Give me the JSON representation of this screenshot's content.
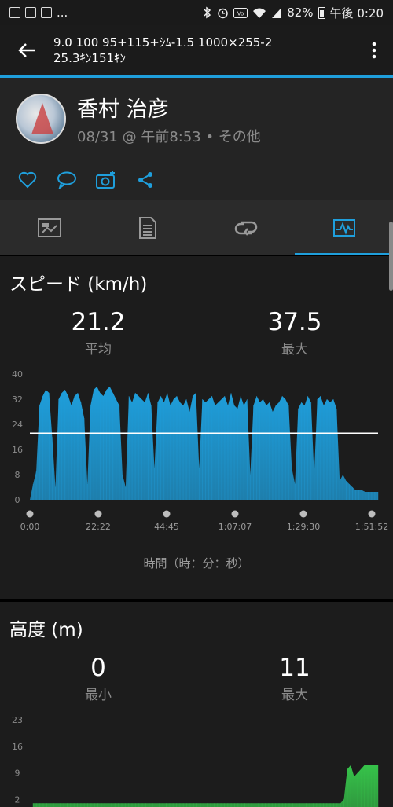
{
  "status_bar": {
    "left_extra": "...",
    "battery": "82%",
    "time": "午後 0:20"
  },
  "header": {
    "title_line1": "9.0 100 95+115+ｼﾑ-1.5 1000×255-2",
    "title_line2": "25.3ｷﾝ151ｷﾝ"
  },
  "profile": {
    "name": "香村 治彦",
    "meta": "08/31 @ 午前8:53 • その他"
  },
  "tabs": [
    {
      "icon": "summary-icon"
    },
    {
      "icon": "details-list-icon"
    },
    {
      "icon": "laps-icon"
    },
    {
      "icon": "chart-icon",
      "active": true
    }
  ],
  "speed": {
    "title": "スピード (km/h)",
    "avg_value": "21.2",
    "avg_label": "平均",
    "max_value": "37.5",
    "max_label": "最大",
    "axis_caption": "時間（時：分：秒）",
    "color": "#1f9fdc"
  },
  "elevation": {
    "title": "高度 (m)",
    "min_value": "0",
    "min_label": "最小",
    "max_value": "11",
    "max_label": "最大",
    "color": "#36c24a"
  },
  "chart_data": [
    {
      "type": "area",
      "title": "スピード (km/h)",
      "xlabel": "時間（時：分：秒）",
      "ylabel": "",
      "ylim": [
        0,
        40
      ],
      "yticks": [
        "0",
        "8",
        "16",
        "24",
        "32",
        "40"
      ],
      "xticks": [
        "0:00",
        "22:22",
        "44:45",
        "1:07:07",
        "1:29:30",
        "1:51:52"
      ],
      "average_line": 21.2,
      "series": [
        {
          "values": [
            0,
            5,
            9,
            30,
            33,
            35,
            34,
            20,
            4,
            32,
            34,
            35,
            33,
            30,
            33,
            34,
            31,
            26,
            5,
            30,
            35,
            36,
            34,
            33,
            35,
            36,
            34,
            32,
            30,
            8,
            4,
            33,
            31,
            34,
            33,
            32,
            31,
            34,
            30,
            10,
            31,
            33,
            31,
            34,
            30,
            32,
            33,
            31,
            30,
            32,
            28,
            33,
            34,
            10,
            32,
            31,
            32,
            33,
            30,
            31,
            32,
            33,
            30,
            34,
            30,
            29,
            33,
            30,
            32,
            8,
            30,
            33,
            31,
            32,
            30,
            31,
            28,
            30,
            31,
            33,
            32,
            30,
            10,
            5,
            29,
            31,
            30,
            33,
            31,
            8,
            32,
            33,
            30,
            32,
            31,
            32,
            29,
            6,
            8,
            6,
            5,
            4,
            3,
            3,
            3,
            2.5,
            2.5,
            2.5,
            2.5,
            2.5
          ]
        }
      ]
    },
    {
      "type": "area",
      "title": "高度 (m)",
      "xlabel": "",
      "ylabel": "",
      "ylim": [
        0,
        23
      ],
      "yticks": [
        "2",
        "9",
        "16",
        "23"
      ],
      "series": [
        {
          "values": [
            1,
            1,
            1,
            1,
            1,
            1,
            1,
            1,
            1,
            1,
            1,
            1,
            1,
            1,
            1,
            1,
            1,
            1,
            1,
            1,
            1,
            1,
            1,
            1,
            1,
            1,
            1,
            1,
            1,
            1,
            1,
            1,
            1,
            1,
            1,
            1,
            1,
            1,
            1,
            1,
            1,
            1,
            1,
            1,
            1,
            1,
            1,
            1,
            1,
            1,
            1,
            1,
            1,
            1,
            1,
            1,
            1,
            1,
            1,
            1,
            1,
            1,
            1,
            1,
            1,
            1,
            1,
            1,
            1,
            1,
            1,
            1,
            1,
            1,
            1,
            1,
            1,
            1,
            1,
            1,
            1,
            1,
            1,
            1,
            1,
            1,
            1,
            1,
            1,
            1,
            1,
            2,
            10,
            11,
            8,
            9,
            10,
            11,
            11,
            11,
            11,
            11
          ]
        }
      ]
    }
  ]
}
